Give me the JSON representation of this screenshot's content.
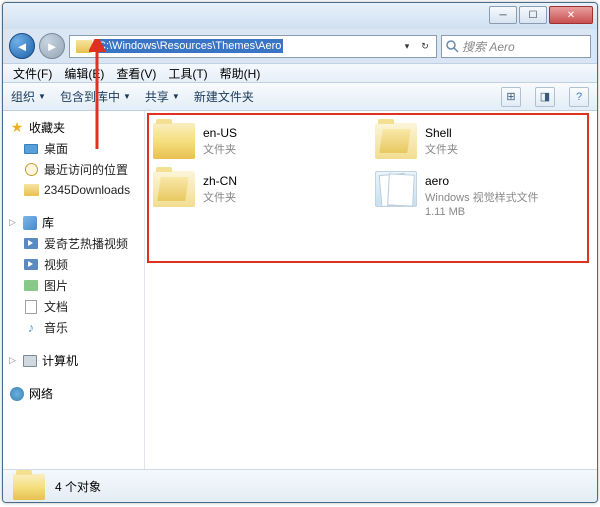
{
  "address_path": "C:\\Windows\\Resources\\Themes\\Aero",
  "search_placeholder": "搜索 Aero",
  "menu": {
    "file": "文件(F)",
    "edit": "编辑(E)",
    "view": "查看(V)",
    "tools": "工具(T)",
    "help": "帮助(H)"
  },
  "toolbar": {
    "organize": "组织",
    "include": "包含到库中",
    "share": "共享",
    "newfolder": "新建文件夹"
  },
  "sidebar": {
    "favorites": "收藏夹",
    "fav_items": [
      "桌面",
      "最近访问的位置",
      "2345Downloads"
    ],
    "libraries": "库",
    "lib_items": [
      "爱奇艺热播视频",
      "视频",
      "图片",
      "文档",
      "音乐"
    ],
    "computer": "计算机",
    "network": "网络"
  },
  "items": [
    {
      "name": "en-US",
      "sub": "文件夹",
      "kind": "folder"
    },
    {
      "name": "Shell",
      "sub": "文件夹",
      "kind": "folder-open"
    },
    {
      "name": "zh-CN",
      "sub": "文件夹",
      "kind": "folder-open"
    },
    {
      "name": "aero",
      "sub": "Windows 视觉样式文件",
      "size": "1.11 MB",
      "kind": "theme"
    }
  ],
  "status": {
    "count": "4 个对象"
  }
}
